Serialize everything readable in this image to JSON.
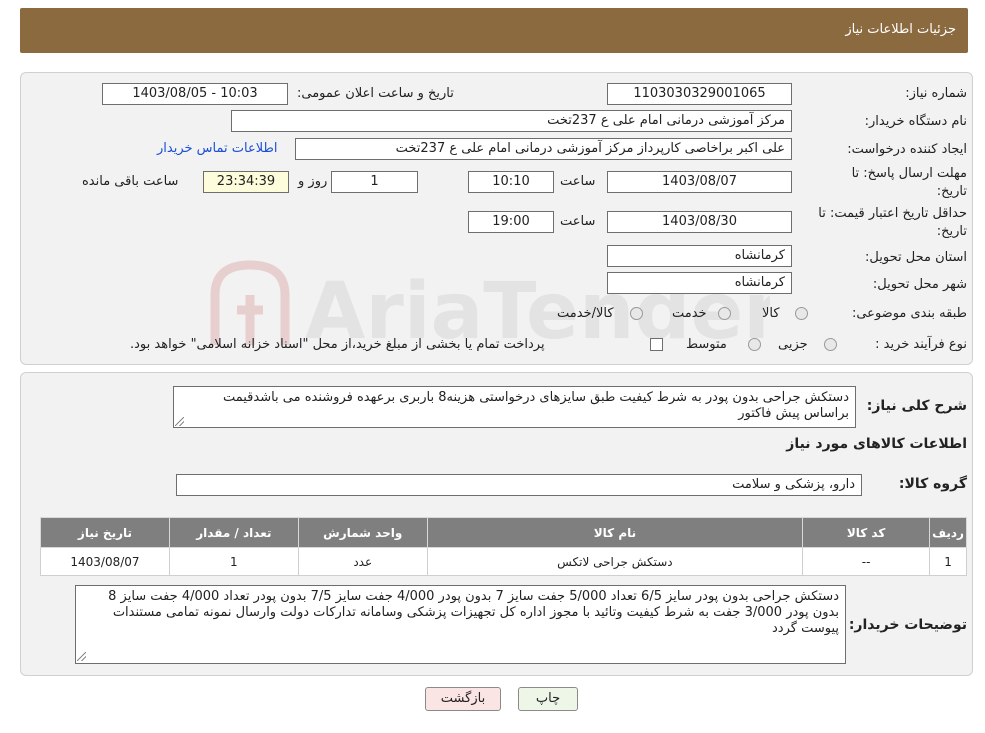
{
  "header": {
    "title": "جزئیات اطلاعات نیاز"
  },
  "watermark": {
    "text": "AriaTender.neT"
  },
  "info": {
    "need_number_label": "شماره نیاز:",
    "need_number": "1103030329001065",
    "announce_label": "تاریخ و ساعت اعلان عمومی:",
    "announce_value": "1403/08/05 - 10:03",
    "buyer_org_label": "نام دستگاه خریدار:",
    "buyer_org": "مرکز آموزشی درمانی امام علی ع 237تخت",
    "creator_label": "ایجاد کننده درخواست:",
    "creator": "علی اکبر براخاصی کارپرداز  مرکز آموزشی درمانی امام علی ع 237تخت",
    "contact_link": "اطلاعات تماس خریدار",
    "deadline_label_1": "مهلت ارسال پاسخ: تا",
    "deadline_label_2": "تاریخ:",
    "deadline_date": "1403/08/07",
    "time_label": "ساعت",
    "deadline_time": "10:10",
    "days_value": "1",
    "days_label": "روز و",
    "remaining_time": "23:34:39",
    "remaining_label": "ساعت باقی مانده",
    "validity_label_1": "حداقل تاریخ اعتبار قیمت: تا",
    "validity_label_2": "تاریخ:",
    "validity_date": "1403/08/30",
    "validity_time": "19:00",
    "province_label": "استان محل تحویل:",
    "province": "کرمانشاه",
    "city_label": "شهر محل تحویل:",
    "city": "کرمانشاه",
    "category_label": "طبقه بندی موضوعی:",
    "category_options": [
      "کالا",
      "خدمت",
      "کالا/خدمت"
    ],
    "process_label": "نوع فرآیند خرید :",
    "process_options": [
      "جزیی",
      "متوسط"
    ],
    "payment_note": "پرداخت تمام یا بخشی از مبلغ خرید،از محل \"اسناد خزانه اسلامی\" خواهد بود."
  },
  "summary": {
    "label": "شرح کلی نیاز:",
    "text": "دستکش جراحی بدون پودر به شرط کیفیت طبق سایزهای درخواستی هزینه8 باربری برعهده فروشنده می باشدقیمت براساس پیش فاکتور"
  },
  "goods": {
    "section_title": "اطلاعات کالاهای مورد نیاز",
    "group_label": "گروه کالا:",
    "group_value": "دارو، پزشکی و سلامت",
    "columns": [
      "ردیف",
      "کد کالا",
      "نام کالا",
      "واحد شمارش",
      "تعداد / مقدار",
      "تاریخ نیاز"
    ],
    "rows": [
      {
        "index": "1",
        "code": "--",
        "name": "دستکش جراحی لاتکس",
        "unit": "عدد",
        "qty": "1",
        "date": "1403/08/07"
      }
    ]
  },
  "buyer_notes": {
    "label": "توضیحات خریدار:",
    "text": "دستکش جراحی بدون پودر سایز 6/5 تعداد 5/000 جفت سایز 7 بدون پودر 4/000 جفت سایز 7/5 بدون پودر تعداد  4/000 جفت سایز 8 بدون پودر 3/000 جفت به شرط کیفیت وتائید با مجوز اداره کل تجهیزات پزشکی وسامانه تدارکات دولت وارسال نمونه تمامی مستندات پیوست گردد"
  },
  "buttons": {
    "print": "چاپ",
    "back": "بازگشت"
  },
  "colors": {
    "header": "#8c6a3f",
    "table_header": "#7f7f7f",
    "link": "#1a4fd6",
    "back_button": "#fbe4e4"
  }
}
